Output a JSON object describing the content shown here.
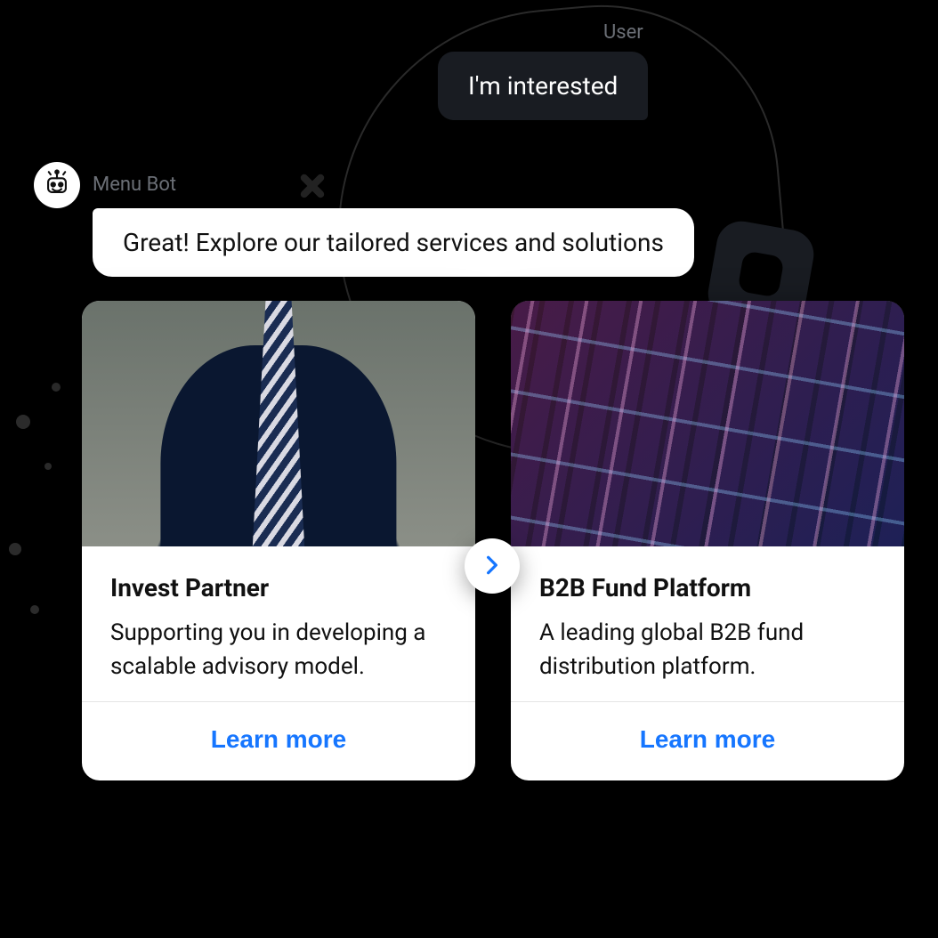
{
  "user": {
    "label": "User",
    "message": "I'm interested"
  },
  "bot": {
    "name": "Menu Bot",
    "message": "Great! Explore our tailored services and solutions"
  },
  "cards": [
    {
      "title": "Invest Partner",
      "description": "Supporting you in developing a scalable advisory model.",
      "cta": "Learn more",
      "image_alt": "businessman-in-suit"
    },
    {
      "title": "B2B Fund Platform",
      "description": "A leading global B2B fund distribution platform.",
      "cta": "Learn more",
      "image_alt": "office-building-at-night"
    }
  ],
  "colors": {
    "link": "#1676ff",
    "bg": "#000000",
    "user_bubble": "#191c22",
    "bot_bubble": "#ffffff"
  }
}
